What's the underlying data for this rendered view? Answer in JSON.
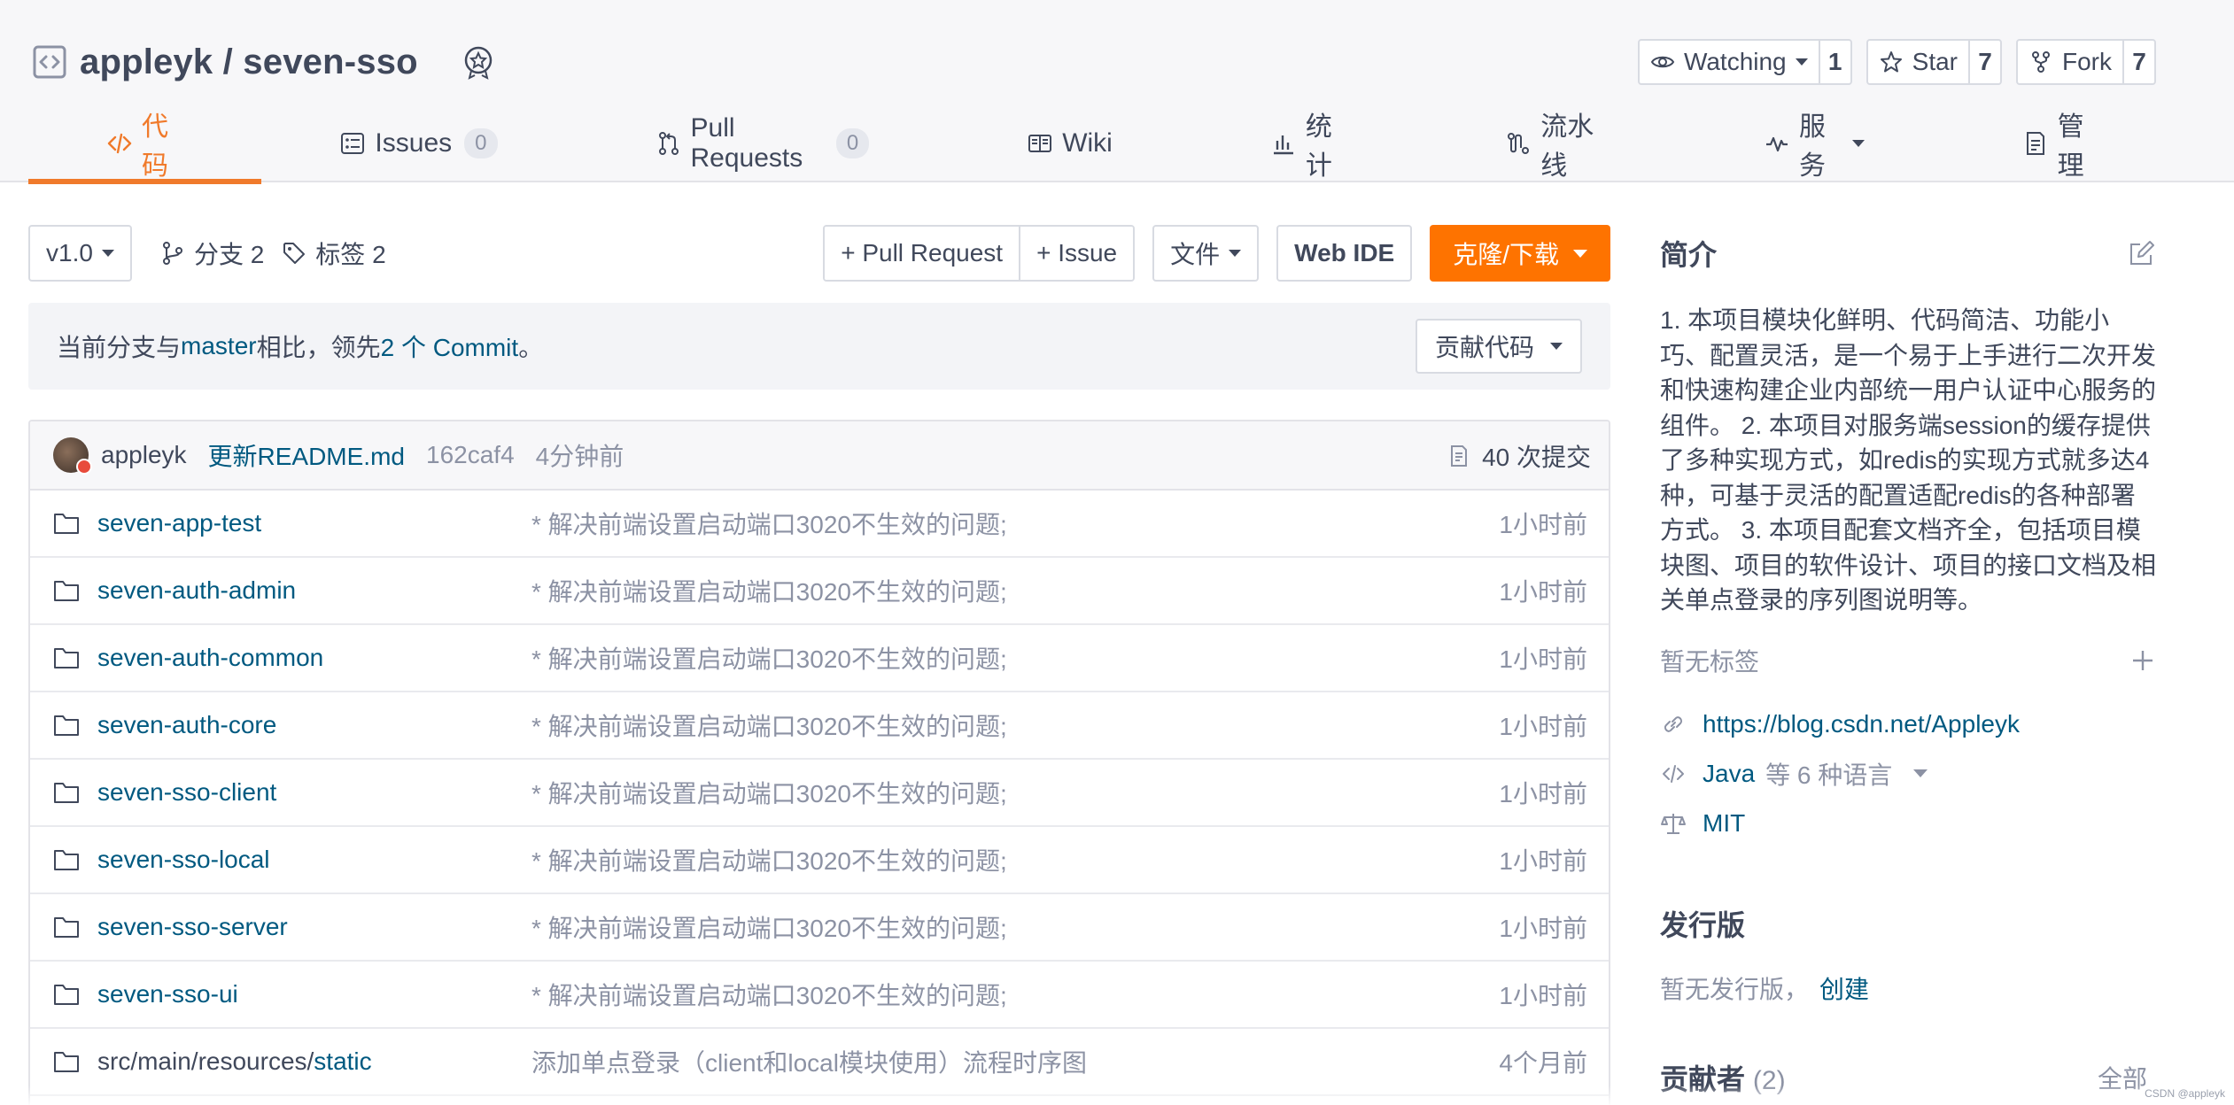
{
  "repo": {
    "title": "appleyk / seven-sso",
    "watch_label": "Watching",
    "watch_count": "1",
    "star_label": "Star",
    "star_count": "7",
    "fork_label": "Fork",
    "fork_count": "7"
  },
  "tabs": [
    {
      "label": "代码",
      "icon": "code-icon",
      "active": true
    },
    {
      "label": "Issues",
      "count": "0",
      "icon": "issues-icon"
    },
    {
      "label": "Pull Requests",
      "count": "0",
      "icon": "pull-request-icon"
    },
    {
      "label": "Wiki",
      "icon": "wiki-icon"
    },
    {
      "label": "统计",
      "icon": "stats-icon"
    },
    {
      "label": "流水线",
      "icon": "pipeline-icon"
    },
    {
      "label": "服务",
      "icon": "service-icon"
    },
    {
      "label": "管理",
      "icon": "manage-icon"
    }
  ],
  "toolbar": {
    "branch_selector": "v1.0",
    "branches_label": "分支 2",
    "tags_label": "标签 2",
    "pull_request_button": "+ Pull Request",
    "issue_button": "+ Issue",
    "file_button": "文件",
    "web_ide_button": "Web IDE",
    "clone_button": "克隆/下载"
  },
  "compare": {
    "prefix": "当前分支与 ",
    "branch": "master",
    "middle": " 相比，领先 ",
    "commits": "2 个 Commit",
    "suffix": "。",
    "contribute_button": "贡献代码"
  },
  "last_commit": {
    "author": "appleyk",
    "message": "更新README.md",
    "sha": "162caf4",
    "time": "4分钟前",
    "total_commits": "40 次提交"
  },
  "files": [
    {
      "name": "seven-app-test",
      "message": "* 解决前端设置启动端口3020不生效的问题;",
      "time": "1小时前"
    },
    {
      "name": "seven-auth-admin",
      "message": "* 解决前端设置启动端口3020不生效的问题;",
      "time": "1小时前"
    },
    {
      "name": "seven-auth-common",
      "message": "* 解决前端设置启动端口3020不生效的问题;",
      "time": "1小时前"
    },
    {
      "name": "seven-auth-core",
      "message": "* 解决前端设置启动端口3020不生效的问题;",
      "time": "1小时前"
    },
    {
      "name": "seven-sso-client",
      "message": "* 解决前端设置启动端口3020不生效的问题;",
      "time": "1小时前"
    },
    {
      "name": "seven-sso-local",
      "message": "* 解决前端设置启动端口3020不生效的问题;",
      "time": "1小时前"
    },
    {
      "name": "seven-sso-server",
      "message": "* 解决前端设置启动端口3020不生效的问题;",
      "time": "1小时前"
    },
    {
      "name": "seven-sso-ui",
      "message": "* 解决前端设置启动端口3020不生效的问题;",
      "time": "1小时前"
    },
    {
      "name_prefix": "src/main/resources/",
      "name": "static",
      "message": "添加单点登录（client和local模块使用）流程时序图",
      "time": "4个月前"
    }
  ],
  "sidebar": {
    "intro_title": "简介",
    "description": "1. 本项目模块化鲜明、代码简洁、功能小巧、配置灵活，是一个易于上手进行二次开发和快速构建企业内部统一用户认证中心服务的组件。 2. 本项目对服务端session的缓存提供了多种实现方式，如redis的实现方式就多达4种，可基于灵活的配置适配redis的各种部署方式。 3. 本项目配套文档齐全，包括项目模块图、项目的软件设计、项目的接口文档及相关单点登录的序列图说明等。",
    "no_tags": "暂无标签",
    "homepage": "https://blog.csdn.net/Appleyk",
    "language": "Java",
    "language_more": "等 6 种语言",
    "license": "MIT",
    "releases_title": "发行版",
    "no_releases": "暂无发行版，",
    "create_release": "创建",
    "contributors_title": "贡献者",
    "contributors_count": "(2)",
    "contributors_all": "全部"
  },
  "watermark": "CSDN @appleyk",
  "colors": {
    "accent": "#fe7300",
    "link": "#005980",
    "text": "#40485b",
    "muted": "#8c92a4"
  }
}
